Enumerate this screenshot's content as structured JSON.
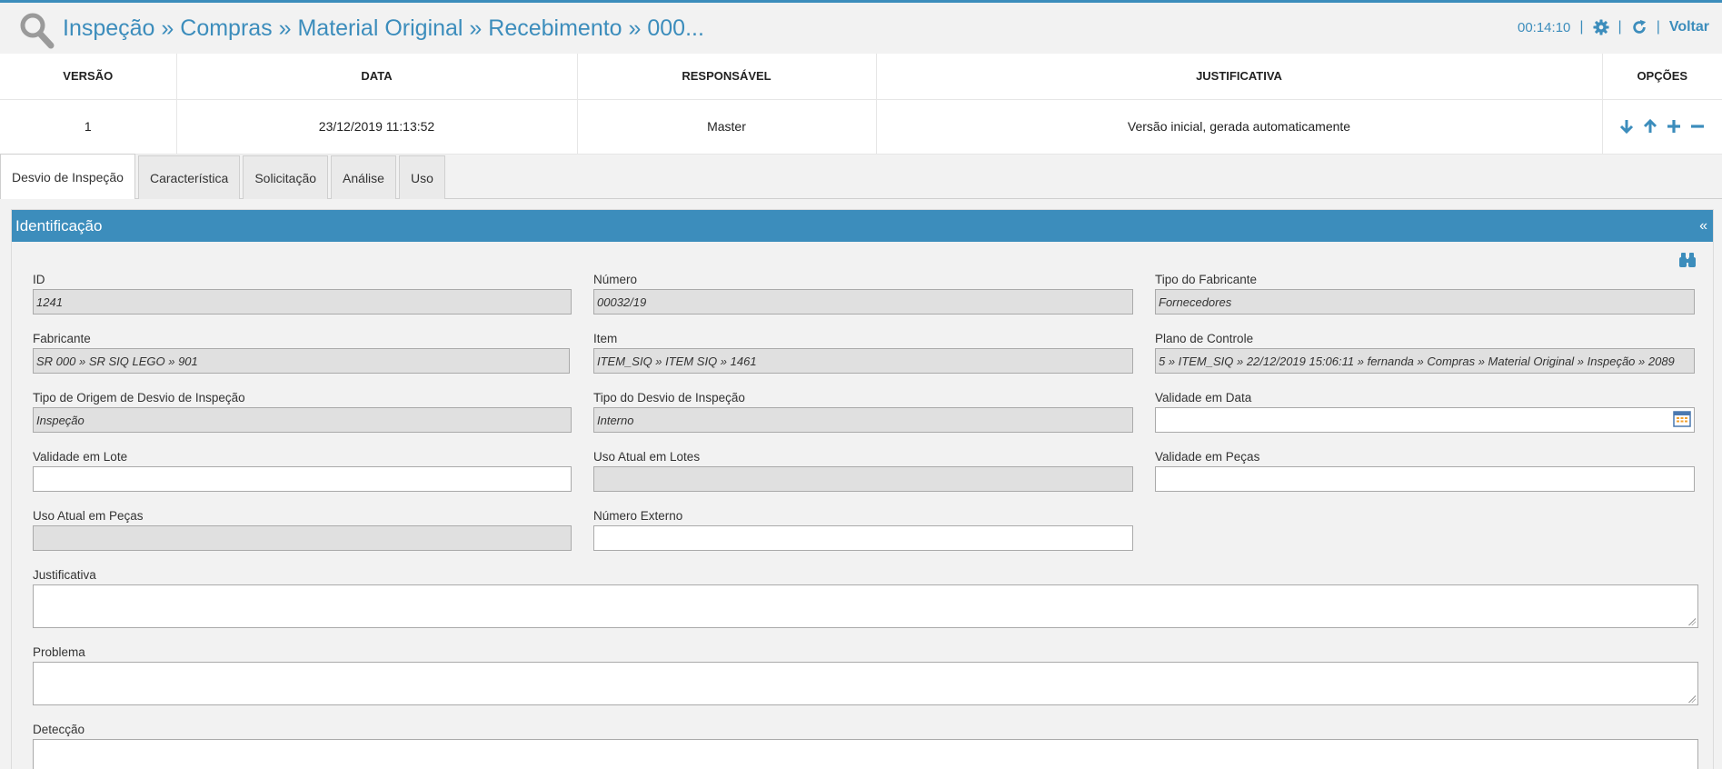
{
  "header": {
    "breadcrumb": "Inspeção » Compras » Material Original » Recebimento » 000...",
    "timer": "00:14:10",
    "sep": "|",
    "back_label": "Voltar"
  },
  "versions": {
    "columns": [
      "VERSÃO",
      "DATA",
      "RESPONSÁVEL",
      "JUSTIFICATIVA",
      "OPÇÕES"
    ],
    "rows": [
      {
        "version": "1",
        "date": "23/12/2019 11:13:52",
        "responsible": "Master",
        "justification": "Versão inicial, gerada automaticamente"
      }
    ]
  },
  "tabs": [
    {
      "label": "Desvio de Inspeção",
      "active": true
    },
    {
      "label": "Característica"
    },
    {
      "label": "Solicitação"
    },
    {
      "label": "Análise"
    },
    {
      "label": "Uso"
    }
  ],
  "panel": {
    "title": "Identificação",
    "collapse_glyph": "«"
  },
  "fields": {
    "id": {
      "label": "ID",
      "value": "1241"
    },
    "numero": {
      "label": "Número",
      "value": "00032/19"
    },
    "tipo_fabricante": {
      "label": "Tipo do Fabricante",
      "value": "Fornecedores"
    },
    "fabricante": {
      "label": "Fabricante",
      "value": "SR 000 » SR SIQ LEGO » 901"
    },
    "item": {
      "label": "Item",
      "value": "ITEM_SIQ » ITEM SIQ » 1461"
    },
    "plano_controle": {
      "label": "Plano de Controle",
      "value": "5 » ITEM_SIQ » 22/12/2019 15:06:11 » fernanda » Compras » Material Original » Inspeção » 2089"
    },
    "tipo_origem": {
      "label": "Tipo de Origem de Desvio de Inspeção",
      "value": "Inspeção"
    },
    "tipo_desvio": {
      "label": "Tipo do Desvio de Inspeção",
      "value": "Interno"
    },
    "validade_data": {
      "label": "Validade em Data",
      "value": ""
    },
    "validade_lote": {
      "label": "Validade em Lote",
      "value": ""
    },
    "uso_lotes": {
      "label": "Uso Atual em Lotes",
      "value": ""
    },
    "validade_pecas": {
      "label": "Validade em Peças",
      "value": ""
    },
    "uso_pecas": {
      "label": "Uso Atual em Peças",
      "value": ""
    },
    "numero_externo": {
      "label": "Número Externo",
      "value": ""
    },
    "justificativa": {
      "label": "Justificativa",
      "value": ""
    },
    "problema": {
      "label": "Problema",
      "value": ""
    },
    "deteccao": {
      "label": "Detecção",
      "value": ""
    }
  },
  "colors": {
    "accent": "#3c8dbc",
    "readonly": "#e0e0e0"
  }
}
